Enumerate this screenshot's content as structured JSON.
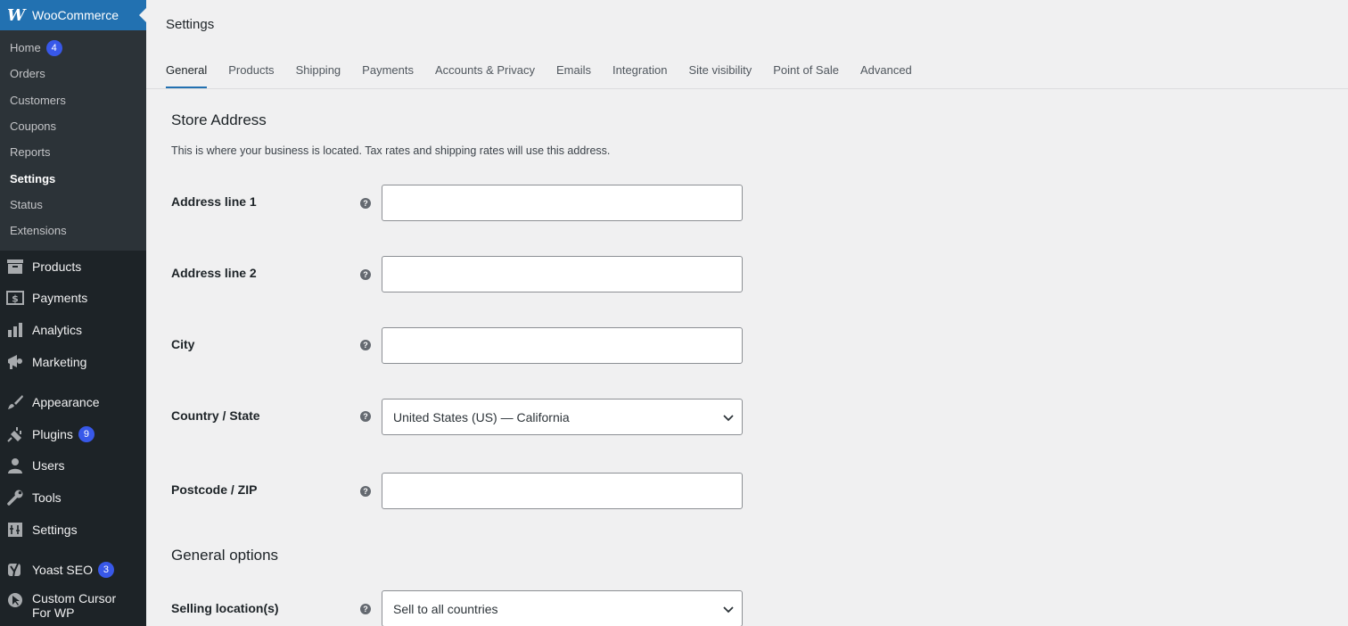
{
  "sidebar": {
    "brand": "WooCommerce",
    "woo_submenu": [
      {
        "label": "Home",
        "badge": "4"
      },
      {
        "label": "Orders"
      },
      {
        "label": "Customers"
      },
      {
        "label": "Coupons"
      },
      {
        "label": "Reports"
      },
      {
        "label": "Settings",
        "current": true
      },
      {
        "label": "Status"
      },
      {
        "label": "Extensions"
      }
    ],
    "menu": [
      {
        "label": "Products",
        "icon": "archive-icon"
      },
      {
        "label": "Payments",
        "icon": "dollar-icon"
      },
      {
        "label": "Analytics",
        "icon": "bar-chart-icon"
      },
      {
        "label": "Marketing",
        "icon": "megaphone-icon"
      },
      {
        "label": "Appearance",
        "icon": "brush-icon"
      },
      {
        "label": "Plugins",
        "icon": "plug-icon",
        "badge": "9"
      },
      {
        "label": "Users",
        "icon": "user-icon"
      },
      {
        "label": "Tools",
        "icon": "wrench-icon"
      },
      {
        "label": "Settings",
        "icon": "settings-icon"
      },
      {
        "label": "Yoast SEO",
        "icon": "yoast-icon",
        "badge": "3"
      },
      {
        "label": "Custom Cursor For WP",
        "icon": "cursor-icon"
      }
    ]
  },
  "header": {
    "title": "Settings",
    "tabs": [
      "General",
      "Products",
      "Shipping",
      "Payments",
      "Accounts & Privacy",
      "Emails",
      "Integration",
      "Site visibility",
      "Point of Sale",
      "Advanced"
    ],
    "active_tab": "General"
  },
  "store_address": {
    "heading": "Store Address",
    "description": "This is where your business is located. Tax rates and shipping rates will use this address.",
    "fields": {
      "address1": {
        "label": "Address line 1",
        "value": ""
      },
      "address2": {
        "label": "Address line 2",
        "value": ""
      },
      "city": {
        "label": "City",
        "value": ""
      },
      "country": {
        "label": "Country / State",
        "value": "United States (US) — California"
      },
      "postcode": {
        "label": "Postcode / ZIP",
        "value": ""
      }
    }
  },
  "general_options": {
    "heading": "General options",
    "selling_location": {
      "label": "Selling location(s)",
      "value": "Sell to all countries"
    }
  },
  "colors": {
    "accent": "#2271b1",
    "badge": "#3858e9",
    "sidebar_bg": "#1d2327"
  }
}
